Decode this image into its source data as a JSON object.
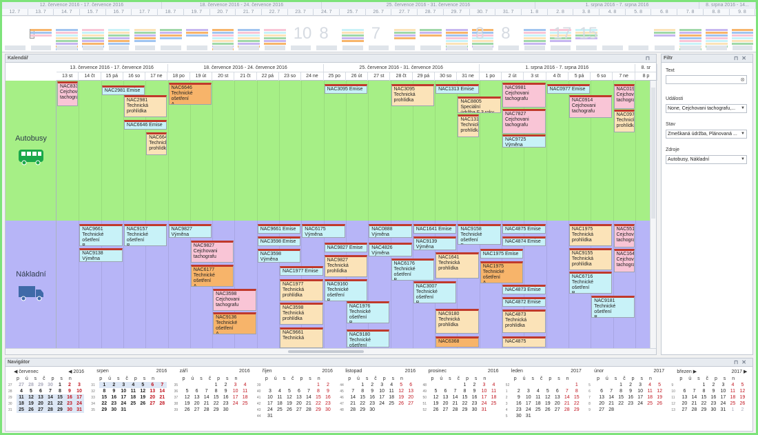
{
  "overview": {
    "week_ranges": [
      "12. července 2016 - 17. července 2016",
      "18. července 2016 - 24. července 2016",
      "25. července 2016 - 31. července 2016",
      "1. srpna 2016 - 7. srpna 2016",
      "8. srpna 2016 - 14..."
    ],
    "days": [
      "12. 7",
      "13. 7",
      "14. 7",
      "15. 7",
      "16. 7",
      "17. 7",
      "18. 7",
      "19. 7",
      "20. 7",
      "21. 7",
      "22. 7",
      "23. 7",
      "24. 7",
      "25. 7",
      "26. 7",
      "27. 7",
      "28. 7",
      "29. 7",
      "30. 7",
      "31. 7",
      "1. 8",
      "2. 8",
      "3. 8",
      "4. 8",
      "5. 8",
      "6. 8",
      "7. 8",
      "8. 8",
      "9. 8"
    ],
    "counts": [
      "10",
      "8",
      "7",
      "8",
      "8",
      "17",
      "15"
    ]
  },
  "calendar": {
    "title": "Kalendář",
    "weeks": [
      "13. července 2016 - 17. července 2016",
      "18. července 2016 - 24. července 2016",
      "25. července 2016 - 31. července 2016",
      "1. srpna 2016 - 7. srpna 2016",
      "8. sr"
    ],
    "days": [
      "13 st",
      "14 čt",
      "15 pá",
      "16 so",
      "17 ne",
      "18 po",
      "19 út",
      "20 st",
      "21 čt",
      "22 pá",
      "23 so",
      "24 ne",
      "25 po",
      "26 út",
      "27 st",
      "28 čt",
      "29 pá",
      "30 so",
      "31 ne",
      "1 po",
      "2 út",
      "3 st",
      "4 čt",
      "5 pá",
      "6 so",
      "7 ne",
      "8 p"
    ],
    "resources": [
      {
        "name": "Autobusy",
        "icon": "bus-icon"
      },
      {
        "name": "Nákladní",
        "icon": "truck-icon"
      }
    ],
    "bus_appointments": [
      "NAC8331\nCejchovani\ntachografu",
      "NAC2981 Emise",
      "NAC2981\nTechnická\nprohlídka",
      "NAC6646 Emise",
      "NAC6646\nTechnická\nprohlídka",
      "NAC6646\nTechnické ošetření\nA",
      "NAC3095 Emise",
      "NAC3095\nTechnická\nprohlídka",
      "NAC1313 Emise",
      "NAC8805 Speciální\núdržba F 3 roky",
      "NAC1313\nTechnická\nprohlídka",
      "NAC9981\nCejchovani\ntachografu",
      "NAC7827\nCejchovani\ntachografu",
      "NAC9725 Výměna\noleje v motoru",
      "NAC0977 Emise",
      "NAC0914\nCejchovani\ntachografu",
      "NAC0190\nCejchovani\ntachografu",
      "NAC0977\nTechnická\nprohlídka"
    ],
    "truck_appointments": [
      "NAC9661\nTechnické ošetření\nB",
      "NAC9138 Výměna\noleje v motoru",
      "NAC9157\nTechnické ošetření\nB",
      "NAC9827 Výměna\noleje v motoru",
      "NAC9827\nCejchovani\ntachografu",
      "NAC6177\nTechnické ošetření\nA",
      "NAC3598\nCejchovani\ntachografu",
      "NAC9136\nTechnické ošetření\nA",
      "NAC9661 Emise",
      "NAC3598 Emise",
      "NAC3598 Výměna\noleje v motoru",
      "NAC1977 Emise",
      "NAC1977\nTechnická\nprohlídka",
      "NAC3598\nTechnická\nprohlídka",
      "NAC9661\nTechnická",
      "NAC6175 Výměna\noleje v motoru",
      "NAC9827 Emise",
      "NAC9827\nTechnická\nprohlídka",
      "NAC9160\nTechnické ošetření\nB",
      "NAC1976\nTechnické ošetření\nB",
      "NAC9180\nTechnické ošetření",
      "NAC0888 Výměna\noleje v motoru",
      "NAC4826 Výměna\noleje v motoru",
      "NAC6176\nTechnické ošetření\nB",
      "NAC1641 Emise",
      "NAC9139 Výměna\noleje v motoru",
      "NAC3007\nTechnické ošetření\nB",
      "NAC1641\nTechnická\nprohlídka",
      "NAC9180\nTechnická\nprohlídka",
      "NAC6368",
      "NAC9158\nTechnické ošetření\nB",
      "NAC1975 Emise",
      "NAC1975\nTechnické ošetření\nA",
      "NAC4875 Emise",
      "NAC4874 Emise",
      "NAC4873 Emise",
      "NAC4872 Emise",
      "NAC4873\nTechnická\nprohlídka",
      "NAC4875",
      "NAC1975\nTechnická\nprohlídka",
      "NAC9155\nTechnická\nprohlídka",
      "NAC6716\nTechnické ošetření\nB",
      "NAC9181\nTechnické ošetření\nB",
      "NAC5517\nCejchovani\ntachografu",
      "NAC1641\nCejchovani\ntachografu"
    ]
  },
  "filter": {
    "title": "Filtr",
    "text_label": "Text",
    "text_value": "",
    "events_label": "Události",
    "events_value": "None, Cejchovani tachografu,...",
    "state_label": "Stav",
    "state_value": "Zmeškaná údržba, Plánovaná ...",
    "sources_label": "Zdroje",
    "sources_value": "Autobusy, Nákladní"
  },
  "navigator": {
    "title": "Navigátor",
    "dow": "p ú s č p s n",
    "months": [
      {
        "name": "červenec",
        "year": "2016",
        "weeks": [
          "27",
          "28",
          "29",
          "30",
          "31"
        ],
        "rows": [
          [
            "27",
            "28",
            "29",
            "30",
            "1",
            "2",
            "3"
          ],
          [
            "4",
            "5",
            "6",
            "7",
            "8",
            "9",
            "10"
          ],
          [
            "11",
            "12",
            "13",
            "14",
            "15",
            "16",
            "17"
          ],
          [
            "18",
            "19",
            "20",
            "21",
            "22",
            "23",
            "24"
          ],
          [
            "25",
            "26",
            "27",
            "28",
            "29",
            "30",
            "31"
          ]
        ]
      },
      {
        "name": "srpen",
        "year": "2016",
        "weeks": [
          "31",
          "32",
          "33",
          "34",
          "35"
        ],
        "rows": [
          [
            "1",
            "2",
            "3",
            "4",
            "5",
            "6",
            "7"
          ],
          [
            "8",
            "9",
            "10",
            "11",
            "12",
            "13",
            "14"
          ],
          [
            "15",
            "16",
            "17",
            "18",
            "19",
            "20",
            "21"
          ],
          [
            "22",
            "23",
            "24",
            "25",
            "26",
            "27",
            "28"
          ],
          [
            "29",
            "30",
            "31",
            "",
            "",
            "",
            ""
          ]
        ]
      },
      {
        "name": "září",
        "year": "2016",
        "weeks": [
          "35",
          "36",
          "37",
          "38",
          "39"
        ],
        "rows": [
          [
            "",
            "",
            "",
            "1",
            "2",
            "3",
            "4"
          ],
          [
            "5",
            "6",
            "7",
            "8",
            "9",
            "10",
            "11"
          ],
          [
            "12",
            "13",
            "14",
            "15",
            "16",
            "17",
            "18"
          ],
          [
            "19",
            "20",
            "21",
            "22",
            "23",
            "24",
            "25"
          ],
          [
            "26",
            "27",
            "28",
            "29",
            "30",
            "",
            ""
          ]
        ]
      },
      {
        "name": "říjen",
        "year": "2016",
        "weeks": [
          "39",
          "40",
          "41",
          "42",
          "43",
          "44"
        ],
        "rows": [
          [
            "",
            "",
            "",
            "",
            "",
            "1",
            "2"
          ],
          [
            "3",
            "4",
            "5",
            "6",
            "7",
            "8",
            "9"
          ],
          [
            "10",
            "11",
            "12",
            "13",
            "14",
            "15",
            "16"
          ],
          [
            "17",
            "18",
            "19",
            "20",
            "21",
            "22",
            "23"
          ],
          [
            "24",
            "25",
            "26",
            "27",
            "28",
            "29",
            "30"
          ],
          [
            "31",
            "",
            "",
            "",
            "",
            "",
            ""
          ]
        ]
      },
      {
        "name": "listopad",
        "year": "2016",
        "weeks": [
          "44",
          "45",
          "46",
          "47",
          "48"
        ],
        "rows": [
          [
            "",
            "1",
            "2",
            "3",
            "4",
            "5",
            "6"
          ],
          [
            "7",
            "8",
            "9",
            "10",
            "11",
            "12",
            "13"
          ],
          [
            "14",
            "15",
            "16",
            "17",
            "18",
            "19",
            "20"
          ],
          [
            "21",
            "22",
            "23",
            "24",
            "25",
            "26",
            "27"
          ],
          [
            "28",
            "29",
            "30",
            "",
            "",
            "",
            ""
          ]
        ]
      },
      {
        "name": "prosinec",
        "year": "2016",
        "weeks": [
          "48",
          "49",
          "50",
          "51",
          "52"
        ],
        "rows": [
          [
            "",
            "",
            "",
            "1",
            "2",
            "3",
            "4"
          ],
          [
            "5",
            "6",
            "7",
            "8",
            "9",
            "10",
            "11"
          ],
          [
            "12",
            "13",
            "14",
            "15",
            "16",
            "17",
            "18"
          ],
          [
            "19",
            "20",
            "21",
            "22",
            "23",
            "24",
            "25"
          ],
          [
            "26",
            "27",
            "28",
            "29",
            "30",
            "31",
            ""
          ]
        ]
      },
      {
        "name": "leden",
        "year": "2017",
        "weeks": [
          "52",
          "1",
          "2",
          "3",
          "4",
          "5"
        ],
        "rows": [
          [
            "",
            "",
            "",
            "",
            "",
            "",
            "1"
          ],
          [
            "2",
            "3",
            "4",
            "5",
            "6",
            "7",
            "8"
          ],
          [
            "9",
            "10",
            "11",
            "12",
            "13",
            "14",
            "15"
          ],
          [
            "16",
            "17",
            "18",
            "19",
            "20",
            "21",
            "22"
          ],
          [
            "23",
            "24",
            "25",
            "26",
            "27",
            "28",
            "29"
          ],
          [
            "30",
            "31",
            "",
            "",
            "",
            "",
            ""
          ]
        ]
      },
      {
        "name": "únor",
        "year": "2017",
        "weeks": [
          "5",
          "6",
          "7",
          "8",
          "9"
        ],
        "rows": [
          [
            "",
            "",
            "1",
            "2",
            "3",
            "4",
            "5"
          ],
          [
            "6",
            "7",
            "8",
            "9",
            "10",
            "11",
            "12"
          ],
          [
            "13",
            "14",
            "15",
            "16",
            "17",
            "18",
            "19"
          ],
          [
            "20",
            "21",
            "22",
            "23",
            "24",
            "25",
            "26"
          ],
          [
            "27",
            "28",
            "",
            "",
            "",
            "",
            ""
          ]
        ]
      },
      {
        "name": "březen",
        "year": "2017",
        "weeks": [
          "9",
          "10",
          "11",
          "12",
          "13"
        ],
        "rows": [
          [
            "",
            "",
            "1",
            "2",
            "3",
            "4",
            "5"
          ],
          [
            "6",
            "7",
            "8",
            "9",
            "10",
            "11",
            "12"
          ],
          [
            "13",
            "14",
            "15",
            "16",
            "17",
            "18",
            "19"
          ],
          [
            "20",
            "21",
            "22",
            "23",
            "24",
            "25",
            "26"
          ],
          [
            "27",
            "28",
            "29",
            "30",
            "31",
            "1",
            "2"
          ]
        ]
      }
    ]
  },
  "colors": {
    "bus_row": "#a6ef86",
    "truck_row": "#b7b5f7",
    "icon": "#1aa84a",
    "truck_icon": "#3f6aa8",
    "accent_red": "#c0392b",
    "selected_week": "#dde7f5"
  }
}
